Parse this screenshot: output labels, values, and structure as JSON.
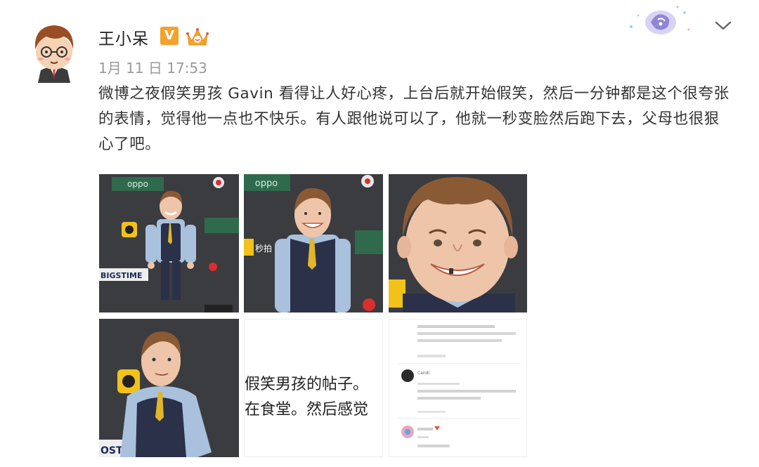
{
  "post": {
    "username": "王小呆",
    "verified_badge": "V",
    "timestamp": "1月 11 日 17:53",
    "text": "微博之夜假笑男孩 Gavin 看得让人好心疼，上台后就开始假笑，然后一分钟都是这个很夸张的表情，觉得他一点也不快乐。有人跟他说可以了，他就一秒变脸然后跑下去，父母也很狠心了吧。"
  },
  "photos": {
    "p1_brand_oppo": "oppo",
    "p1_banner": "BIGSTIME",
    "p2_brand_oppo": "oppo",
    "p2_sponsor": "秒拍",
    "p4_banner": "OST",
    "p5_line1": "假笑男孩的帖子。",
    "p5_line2": "在食堂。然后感觉",
    "p6_comment_author": "Candi"
  },
  "colors": {
    "vbadge": "#f3a22b",
    "text": "#333333",
    "timestamp": "#9a9a9a",
    "backdrop": "#3b3c40",
    "suit": "#2a3148",
    "shirt": "#a9c1dd",
    "tie": "#e1b62a",
    "hair": "#8a5a35",
    "skin": "#eec5a9"
  },
  "icons": [
    "cartoon-avatar",
    "verified-v-icon",
    "crown-icon",
    "chevron-down-icon"
  ]
}
